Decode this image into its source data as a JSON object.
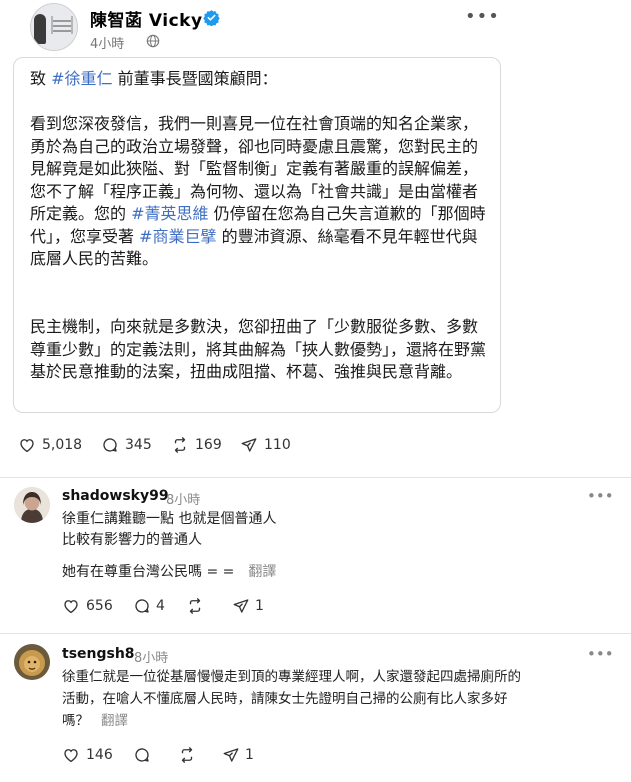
{
  "post": {
    "author": "陳智菡 Vicky",
    "time": "4小時",
    "more_icon": "more-horizontal-icon",
    "paragraphs": {
      "p1": {
        "pre": "致 ",
        "tag": "#徐重仁",
        "post": " 前董事長暨國策顧問："
      },
      "p2": {
        "a": "看到您深夜發信，我們一則喜見一位在社會頂端的知名企業家，勇於為自己的政治立場發聲，卻也同時憂慮且震驚，您對民主的見解竟是如此狹隘、對「監督制衡」定義有著嚴重的誤解偏差，您不了解「程序正義」為何物、還以為「社會共識」是由當權者所定義。您的 ",
        "tag1": "#菁英思維",
        "b": " 仍停留在您為自己失言道歉的「那個時代」，您享受著 ",
        "tag2": "#商業巨擘",
        "c": " 的豐沛資源、絲毫看不見年輕世代與底層人民的苦難。"
      },
      "p3": "民主機制，向來就是多數決，您卻扭曲了「少數服從多數、多數尊重少數」的定義法則，將其曲解為「挾人數優勢」，還將在野黨基於民意推動的法案，扭曲成阻擋、杯葛、強推與民意背離。"
    },
    "stats": {
      "likes": "5,018",
      "comments": "345",
      "reposts": "169",
      "shares": "110"
    }
  },
  "comments": [
    {
      "username": "shadowsky99",
      "time": "8小時",
      "lines": [
        "徐重仁講難聽一點 也就是個普通人",
        "比較有影響力的普通人"
      ],
      "extra": "她有在尊重台灣公民嗎 = =",
      "translate": "翻譯",
      "stats": {
        "likes": "656",
        "comments": "4",
        "reposts": "",
        "shares": "1"
      }
    },
    {
      "username": "tsengsh8",
      "time": "8小時",
      "lines": [
        "徐重仁就是一位從基層慢慢走到頂的專業經理人啊，人家還發起四處掃廁所的",
        "活動，在嗆人不懂底層人民時，請陳女士先證明自己掃的公廁有比人家多好",
        "嗎？"
      ],
      "translate": "翻譯",
      "stats": {
        "likes": "146",
        "comments": "",
        "reposts": "",
        "shares": "1"
      }
    }
  ],
  "colors": {
    "tag": "#3f6fc4",
    "verified": "#1d9bf0",
    "muted": "#8a8a8a"
  }
}
